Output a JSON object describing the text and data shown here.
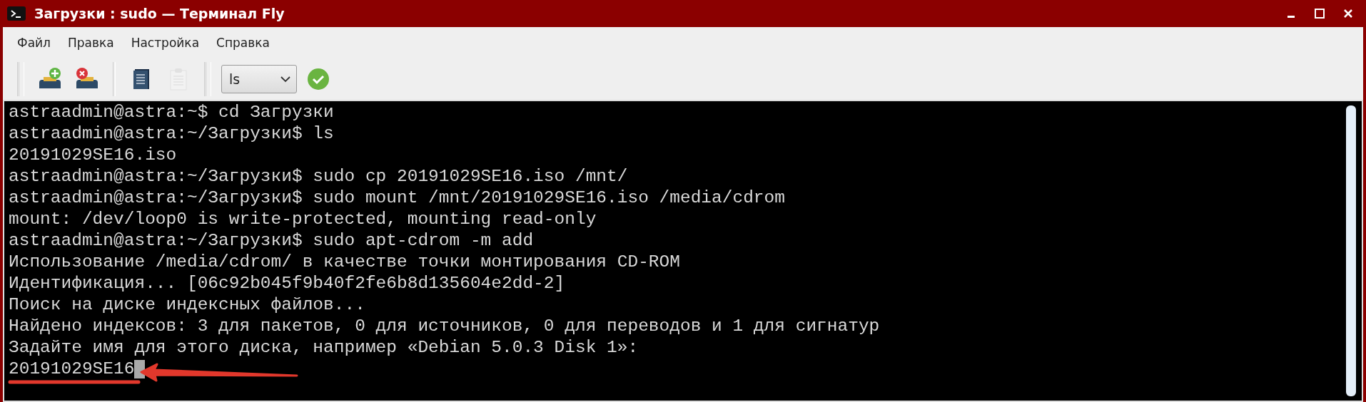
{
  "window": {
    "title": "Загрузки : sudo — Терминал Fly"
  },
  "menu": [
    "Файл",
    "Правка",
    "Настройка",
    "Справка"
  ],
  "toolbar": {
    "buttons": [
      {
        "kind": "new-tab",
        "disabled": false
      },
      {
        "kind": "close-tab",
        "disabled": false
      },
      {
        "kind": "copy",
        "disabled": false
      },
      {
        "kind": "paste",
        "disabled": true
      }
    ],
    "command": {
      "value": "ls"
    },
    "run": {
      "kind": "run",
      "disabled": false
    }
  },
  "terminal": {
    "lines": [
      "astraadmin@astra:~$ cd Загрузки",
      "astraadmin@astra:~/Загрузки$ ls",
      "20191029SE16.iso",
      "astraadmin@astra:~/Загрузки$ sudo cp 20191029SE16.iso /mnt/",
      "astraadmin@astra:~/Загрузки$ sudo mount /mnt/20191029SE16.iso /media/cdrom",
      "mount: /dev/loop0 is write-protected, mounting read-only",
      "astraadmin@astra:~/Загрузки$ sudo apt-cdrom -m add",
      "Использование /media/cdrom/ в качестве точки монтирования CD-ROM",
      "Идентификация... [06c92b045f9b40f2fe6b8d135604e2dd-2]",
      "Поиск на диске индексных файлов...",
      "Найдено индексов: 3 для пакетов, 0 для источников, 0 для переводов и 1 для сигнатур",
      "Задайте имя для этого диска, например «Debian 5.0.3 Disk 1»:"
    ],
    "input": "20191029SE16",
    "cursor": true,
    "annotation": {
      "kind": "underline-arrow"
    }
  }
}
